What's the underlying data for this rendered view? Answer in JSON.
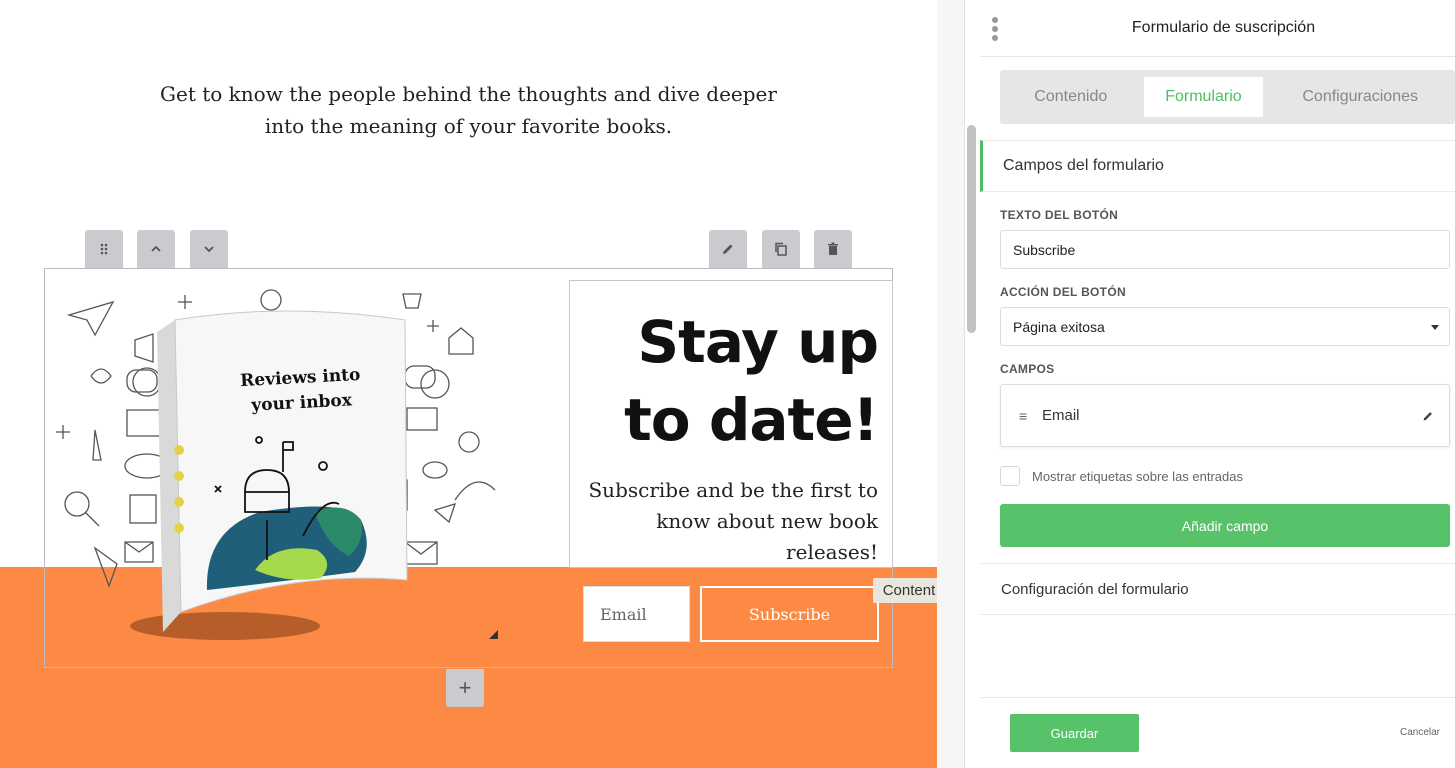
{
  "canvas": {
    "intro_line1": "Get to know the people behind the thoughts and dive deeper",
    "intro_line2": "into the meaning of your favorite books.",
    "headline_line1": "Stay up",
    "headline_line2": "to date!",
    "subtext": "Subscribe and be the first to know about new book releases!",
    "email_placeholder": "Email",
    "subscribe_label": "Subscribe",
    "content_tag": "Content",
    "add_block_label": "+",
    "book_title_line1": "Reviews into",
    "book_title_line2": "your inbox",
    "accent_color": "#fd8a44"
  },
  "toolbar": {
    "icons": [
      "drag-icon",
      "chevron-up-icon",
      "chevron-down-icon",
      "pencil-icon",
      "copy-icon",
      "trash-icon"
    ]
  },
  "panel": {
    "title": "Formulario de suscripción",
    "tabs": [
      {
        "label": "Contenido"
      },
      {
        "label": "Formulario"
      },
      {
        "label": "Configuraciones"
      }
    ],
    "active_tab": "Formulario",
    "section1_title": "Campos del formulario",
    "button_text_label": "TEXTO DEL BOTÓN",
    "button_text_value": "Subscribe",
    "button_action_label": "ACCIÓN DEL BOTÓN",
    "button_action_value": "Página exitosa",
    "fields_label": "CAMPOS",
    "fields": [
      {
        "name": "Email"
      }
    ],
    "show_labels_text": "Mostrar etiquetas sobre las entradas",
    "show_labels_checked": false,
    "add_field_label": "Añadir campo",
    "section2_title": "Configuración del formulario",
    "save_label": "Guardar",
    "cancel_label": "Cancelar",
    "green_color": "#57c26a"
  }
}
